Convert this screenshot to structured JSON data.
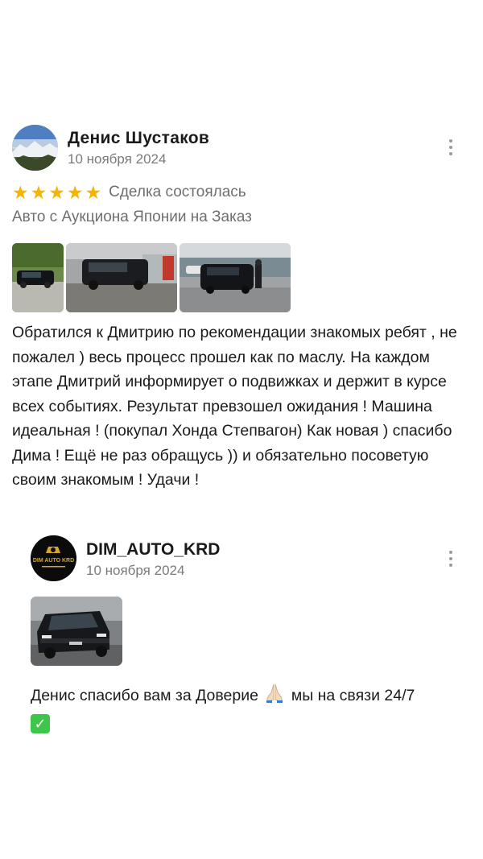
{
  "review": {
    "author": "Денис  Шустаков",
    "date": "10 ноября 2024",
    "rating": 5,
    "stars": [
      "★",
      "★",
      "★",
      "★",
      "★"
    ],
    "deal_status": "Сделка состоялась",
    "service": "Авто с Аукциона Японии на Заказ",
    "photo_count": 3,
    "text": "Обратился к Дмитрию по рекомендации знакомых ребят , не пожалел ) весь процесс прошел как по маслу. На каждом этапе Дмитрий информирует о подвижках и держит в курсе всех событиях. Результат превзошел ожидания ! Машина идеальная ! (покупал Хонда Степвагон) Как новая ) спасибо Дима ! Ещё не раз обращусь )) и обязательно посоветую своим знакомым ! Удачи !"
  },
  "reply": {
    "author": "DIM_AUTO_KRD",
    "logo_text": "DIM AUTO KRD",
    "date": "10 ноября 2024",
    "text_before_emoji": "Денис спасибо вам за Доверие",
    "text_after_emoji": "мы на связи 24/7",
    "check_emoji": "✓"
  },
  "icons": {
    "more": "more-vertical-icon",
    "star": "star-icon",
    "pray": "pray-emoji",
    "check": "check-mark-emoji"
  },
  "colors": {
    "star": "#f6b400",
    "secondary_text": "#6f6f6f",
    "date_text": "#7a7a7a",
    "check_green": "#3ec64a"
  }
}
